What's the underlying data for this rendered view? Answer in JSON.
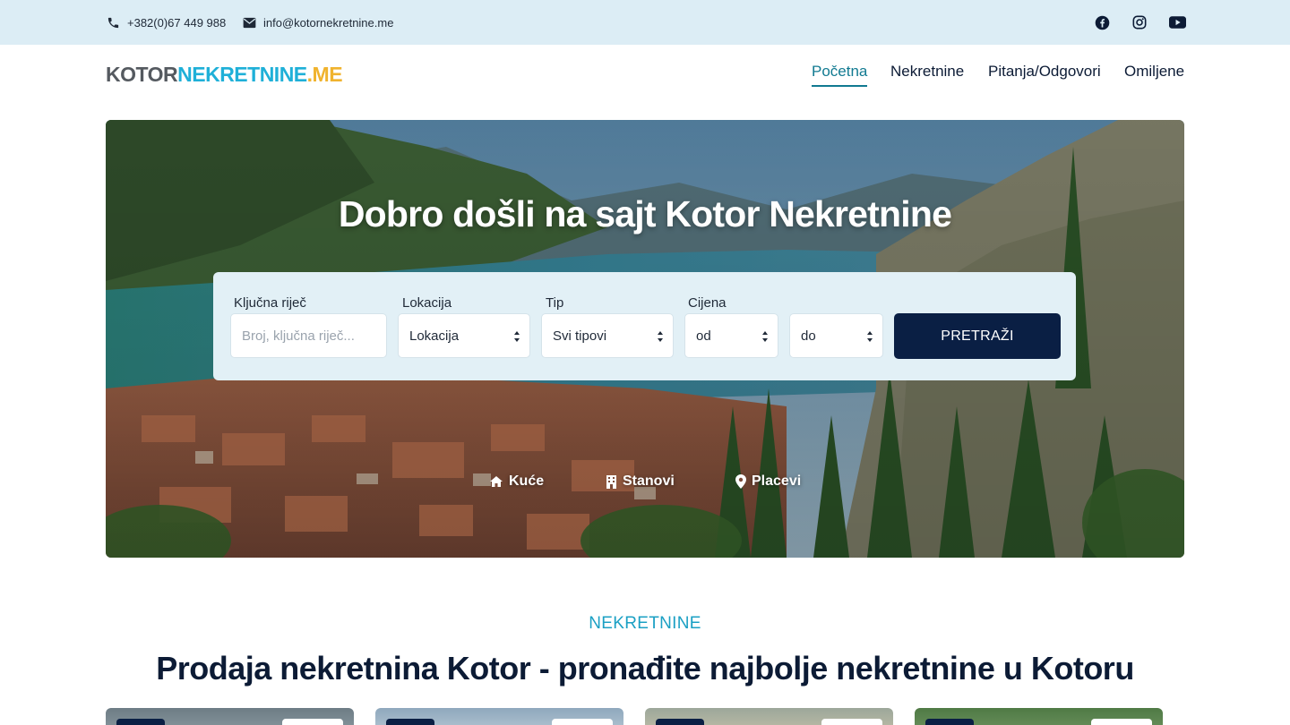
{
  "topbar": {
    "phone": "+382(0)67 449 988",
    "email": "info@kotornekretnine.me",
    "social": [
      "facebook-icon",
      "instagram-icon",
      "youtube-icon"
    ]
  },
  "logo": {
    "part1": "KOTOR",
    "part2": "NEKRETNINE",
    "part3": ".ME"
  },
  "nav": {
    "items": [
      {
        "label": "Početna",
        "active": true
      },
      {
        "label": "Nekretnine",
        "active": false
      },
      {
        "label": "Pitanja/Odgovori",
        "active": false
      },
      {
        "label": "Omiljene",
        "active": false
      }
    ]
  },
  "hero": {
    "title": "Dobro došli na sajt Kotor Nekretnine",
    "search": {
      "keyword_label": "Ključna riječ",
      "keyword_placeholder": "Broj, ključna riječ...",
      "location_label": "Lokacija",
      "location_value": "Lokacija",
      "type_label": "Tip",
      "type_value": "Svi tipovi",
      "price_label": "Cijena",
      "price_from": "od",
      "price_to": "do",
      "button": "PRETRAŽI"
    },
    "categories": [
      {
        "label": "Kuće",
        "icon": "house-icon"
      },
      {
        "label": "Stanovi",
        "icon": "building-icon"
      },
      {
        "label": "Placevi",
        "icon": "map-pin-icon"
      }
    ]
  },
  "section": {
    "eyebrow": "NEKRETNINE",
    "title": "Prodaja nekretnina Kotor - pronađite najbolje nekretnine u Kotoru"
  },
  "colors": {
    "topbar_bg": "#dcedf5",
    "accent": "#1ba0c4",
    "nav_active": "#117a91",
    "navy": "#0a1f44",
    "logo_grey": "#555a60",
    "logo_blue": "#1fb0d8",
    "logo_yellow": "#f0b32e"
  }
}
